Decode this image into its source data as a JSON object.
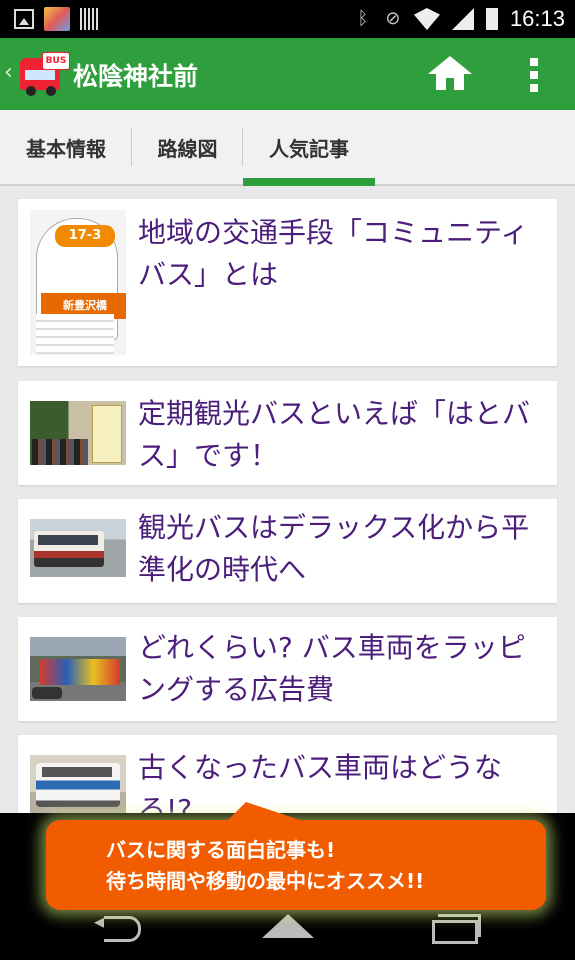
{
  "status_bar": {
    "time": "16:13",
    "icons": [
      "image-icon",
      "app-notification-icon",
      "barcode-icon",
      "bluetooth-icon",
      "vibrate-off-icon",
      "wifi-icon",
      "signal-icon",
      "battery-icon"
    ]
  },
  "app_bar": {
    "title": "松陰神社前",
    "logo_text": "BUS",
    "accent_color": "#2e9f3c"
  },
  "tabs": [
    {
      "label": "基本情報",
      "active": false
    },
    {
      "label": "路線図",
      "active": false
    },
    {
      "label": "人気記事",
      "active": true
    }
  ],
  "sign_thumb": {
    "number": "17-3",
    "station": "新豊沢橋"
  },
  "articles": [
    {
      "title": "地域の交通手段「コミュニティバス」とは"
    },
    {
      "title": "定期観光バスといえば「はとバス」です！"
    },
    {
      "title": "観光バスはデラックス化から平準化の時代へ"
    },
    {
      "title": "どれくらい? バス車両をラッピングする広告費"
    },
    {
      "title": "古くなったバス車両はどうなる!?"
    }
  ],
  "promo": {
    "line1": "バスに関する面白記事も!",
    "line2": "待ち時間や移動の最中にオススメ!!",
    "color": "#f25c00"
  }
}
